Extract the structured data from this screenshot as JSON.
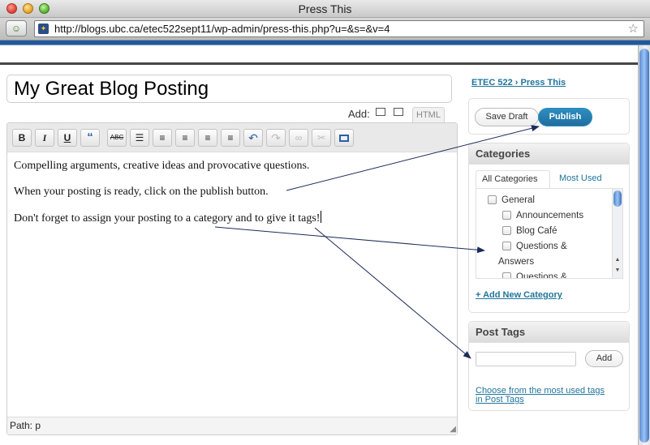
{
  "window": {
    "title": "Press This"
  },
  "browser": {
    "url": "http://blogs.ubc.ca/etec522sept11/wp-admin/press-this.php?u=&s=&v=4",
    "star_icon": "bookmark-star-icon"
  },
  "post": {
    "title": "My Great Blog Posting",
    "add_media_label": "Add:",
    "html_tab_label": "HTML",
    "body": [
      "Compelling arguments, creative ideas and provocative questions.",
      "When your posting is ready, click on the publish button.",
      "Don't forget to assign your posting to a category and to give it tags!"
    ],
    "path_label": "Path: p"
  },
  "toolbar": {
    "bold": "B",
    "italic": "I",
    "underline": "U",
    "blockquote": "“",
    "strikethrough": "ABC"
  },
  "sidebar": {
    "breadcrumb": "ETEC 522 › Press This",
    "save_draft_label": "Save Draft",
    "publish_label": "Publish",
    "categories": {
      "heading": "Categories",
      "tab_all": "All Categories",
      "tab_most_used": "Most Used",
      "items": [
        "General",
        "Announcements",
        "Blog Café",
        "Questions &",
        "Answers",
        "Questions &"
      ],
      "add_new": "+ Add New Category"
    },
    "tags": {
      "heading": "Post Tags",
      "add_label": "Add",
      "input_value": "",
      "choose_link_line1": "Choose from the most used tags",
      "choose_link_line2": "in Post Tags"
    }
  },
  "colors": {
    "link": "#21759b",
    "publish_button": "#2583b5",
    "annotation_arrow": "#1b2c5a"
  }
}
